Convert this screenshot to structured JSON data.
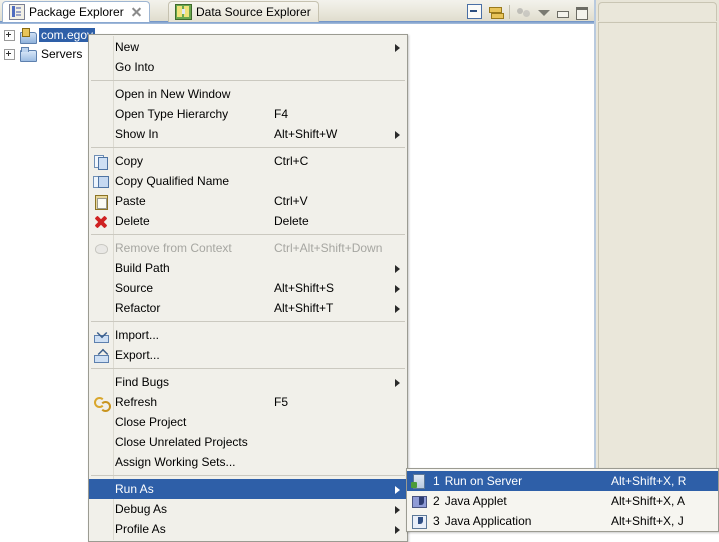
{
  "colors": {
    "menu_bg": "#f1f0ea",
    "highlight": "#2e5fa8",
    "highlight_text": "#ffffff",
    "disabled_text": "#a6a6a1",
    "tree_selection": "#2e5fa8",
    "view_bg": "#e8e5d8",
    "tab_underline": "#6b8fc4"
  },
  "left_view": {
    "tabs": [
      {
        "label": "Package Explorer",
        "icon": "package-explorer-icon",
        "active": true,
        "closable": true
      },
      {
        "label": "Data Source Explorer",
        "icon": "data-source-explorer-icon",
        "active": false,
        "closable": false
      }
    ],
    "toolbar": [
      {
        "name": "collapse-all-icon",
        "enabled": true
      },
      {
        "name": "link-with-editor-icon",
        "enabled": true
      },
      {
        "name": "view-filter-icon",
        "enabled": false
      },
      {
        "name": "view-menu-icon",
        "enabled": true
      },
      {
        "name": "minimize-icon",
        "enabled": true
      },
      {
        "name": "maximize-icon",
        "enabled": true
      }
    ],
    "tree": [
      {
        "label": "com.egov",
        "icon": "java-project-icon",
        "expandable": true,
        "selected": true
      },
      {
        "label": "Servers",
        "icon": "folder-icon",
        "expandable": true,
        "selected": false
      }
    ]
  },
  "context_menu": {
    "items": [
      {
        "label": "New",
        "mnemonic": "w",
        "accel": "",
        "submenu": true,
        "icon": "",
        "state": "normal"
      },
      {
        "label": "Go Into",
        "mnemonic": "I",
        "accel": "",
        "submenu": false,
        "icon": "",
        "state": "normal"
      },
      {
        "separator": true
      },
      {
        "label": "Open in New Window",
        "mnemonic": "N",
        "accel": "",
        "submenu": false,
        "icon": "",
        "state": "normal"
      },
      {
        "label": "Open Type Hierarchy",
        "mnemonic": "n",
        "accel": "F4",
        "submenu": false,
        "icon": "",
        "state": "normal"
      },
      {
        "label": "Show In",
        "mnemonic": "w",
        "accel": "Alt+Shift+W",
        "submenu": true,
        "icon": "",
        "state": "normal"
      },
      {
        "separator": true
      },
      {
        "label": "Copy",
        "mnemonic": "C",
        "accel": "Ctrl+C",
        "submenu": false,
        "icon": "copy-icon",
        "state": "normal"
      },
      {
        "label": "Copy Qualified Name",
        "mnemonic": "y",
        "accel": "",
        "submenu": false,
        "icon": "copy-qualified-name-icon",
        "state": "normal"
      },
      {
        "label": "Paste",
        "mnemonic": "P",
        "accel": "Ctrl+V",
        "submenu": false,
        "icon": "paste-icon",
        "state": "normal"
      },
      {
        "label": "Delete",
        "mnemonic": "D",
        "accel": "Delete",
        "submenu": false,
        "icon": "delete-icon",
        "state": "normal"
      },
      {
        "separator": true
      },
      {
        "label": "Remove from Context",
        "mnemonic": "",
        "accel": "Ctrl+Alt+Shift+Down",
        "submenu": false,
        "icon": "remove-from-context-icon",
        "state": "disabled"
      },
      {
        "label": "Build Path",
        "mnemonic": "B",
        "accel": "",
        "submenu": true,
        "icon": "",
        "state": "normal"
      },
      {
        "label": "Source",
        "mnemonic": "S",
        "accel": "Alt+Shift+S",
        "submenu": true,
        "icon": "",
        "state": "normal"
      },
      {
        "label": "Refactor",
        "mnemonic": "t",
        "accel": "Alt+Shift+T",
        "submenu": true,
        "icon": "",
        "state": "normal"
      },
      {
        "separator": true
      },
      {
        "label": "Import...",
        "mnemonic": "I",
        "accel": "",
        "submenu": false,
        "icon": "import-icon",
        "state": "normal"
      },
      {
        "label": "Export...",
        "mnemonic": "o",
        "accel": "",
        "submenu": false,
        "icon": "export-icon",
        "state": "normal"
      },
      {
        "separator": true
      },
      {
        "label": "Find Bugs",
        "mnemonic": "",
        "accel": "",
        "submenu": true,
        "icon": "",
        "state": "normal"
      },
      {
        "label": "Refresh",
        "mnemonic": "f",
        "accel": "F5",
        "submenu": false,
        "icon": "refresh-icon",
        "state": "normal"
      },
      {
        "label": "Close Project",
        "mnemonic": "s",
        "accel": "",
        "submenu": false,
        "icon": "",
        "state": "normal"
      },
      {
        "label": "Close Unrelated Projects",
        "mnemonic": "U",
        "accel": "",
        "submenu": false,
        "icon": "",
        "state": "normal"
      },
      {
        "label": "Assign Working Sets...",
        "mnemonic": "A",
        "accel": "",
        "submenu": false,
        "icon": "",
        "state": "normal"
      },
      {
        "separator": true
      },
      {
        "label": "Run As",
        "mnemonic": "R",
        "accel": "",
        "submenu": true,
        "icon": "",
        "state": "highlight"
      },
      {
        "label": "Debug As",
        "mnemonic": "D",
        "accel": "",
        "submenu": true,
        "icon": "",
        "state": "normal"
      },
      {
        "label": "Profile As",
        "mnemonic": "P",
        "accel": "",
        "submenu": true,
        "icon": "",
        "state": "normal"
      }
    ]
  },
  "run_as_submenu": {
    "items": [
      {
        "number": "1",
        "label": "Run on Server",
        "accel": "Alt+Shift+X, R",
        "icon": "run-on-server-icon",
        "state": "highlight"
      },
      {
        "number": "2",
        "label": "Java Applet",
        "accel": "Alt+Shift+X, A",
        "icon": "java-applet-icon",
        "state": "normal"
      },
      {
        "number": "3",
        "label": "Java Application",
        "accel": "Alt+Shift+X, J",
        "icon": "java-application-icon",
        "state": "normal"
      }
    ]
  }
}
